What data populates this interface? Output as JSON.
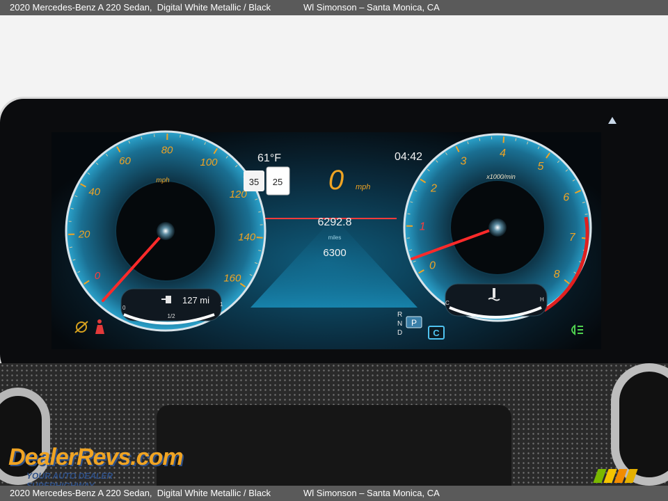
{
  "caption": {
    "title": "2020 Mercedes-Benz A 220 Sedan,  Digital White Metallic / Black",
    "dealer": "Wl Simonson – Santa Monica, CA"
  },
  "cluster": {
    "temperature": "61°F",
    "speed_limit_a": "35",
    "speed_limit_b": "25",
    "clock": "04:42",
    "speed_value": "0",
    "speed_unit": "mph",
    "trip_distance": "6292.8",
    "trip_unit": "miles",
    "odometer": "6300",
    "range_value": "127 mi",
    "fuel_fraction": "1/2",
    "fuel_empty": "0",
    "fuel_full": "1",
    "gear_r": "R",
    "gear_n": "N",
    "gear_d": "D",
    "gear_selected": "P",
    "drive_mode": "C",
    "coolant_cold": "C",
    "coolant_hot": "H"
  },
  "speedometer": {
    "unit_label": "mph",
    "ticks": [
      "0",
      "20",
      "40",
      "60",
      "80",
      "100",
      "120",
      "140",
      "160"
    ],
    "needle_value_mph": 0
  },
  "tachometer": {
    "unit_label": "x1000/min",
    "ticks": [
      "0",
      "1",
      "2",
      "3",
      "4",
      "5",
      "6",
      "7",
      "8"
    ],
    "needle_value_krpm": 0.7
  },
  "watermark": {
    "brand": "DealerRevs.com",
    "tagline": "YOUR AUTO DEALER SUPERHIGHWAY"
  },
  "colors": {
    "accent_orange": "#f0a423",
    "needle_red": "#ff2a2a",
    "gauge_blue": "#1b8fb8",
    "logo_blue": "#2e4f86"
  }
}
